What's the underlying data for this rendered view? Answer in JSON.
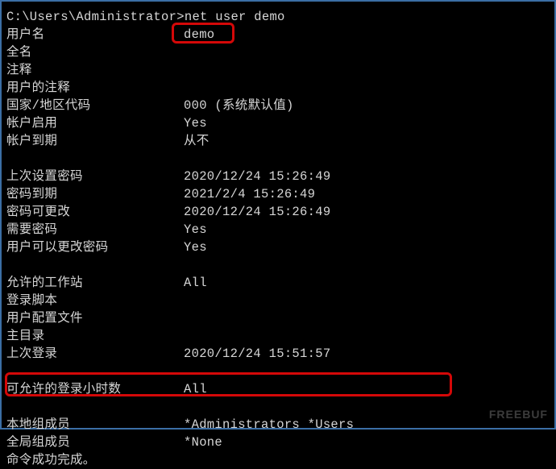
{
  "prompt": {
    "path": "C:\\Users\\Administrator>",
    "command": "net user demo"
  },
  "rows": [
    {
      "label": "用户名",
      "value": "demo"
    },
    {
      "label": "全名",
      "value": ""
    },
    {
      "label": "注释",
      "value": ""
    },
    {
      "label": "用户的注释",
      "value": ""
    },
    {
      "label": "国家/地区代码",
      "value": "000 (系统默认值)"
    },
    {
      "label": "帐户启用",
      "value": "Yes"
    },
    {
      "label": "帐户到期",
      "value": "从不"
    },
    {
      "blank": true
    },
    {
      "label": "上次设置密码",
      "value": "2020/12/24 15:26:49"
    },
    {
      "label": "密码到期",
      "value": "2021/2/4 15:26:49"
    },
    {
      "label": "密码可更改",
      "value": "2020/12/24 15:26:49"
    },
    {
      "label": "需要密码",
      "value": "Yes"
    },
    {
      "label": "用户可以更改密码",
      "value": "Yes"
    },
    {
      "blank": true
    },
    {
      "label": "允许的工作站",
      "value": "All"
    },
    {
      "label": "登录脚本",
      "value": ""
    },
    {
      "label": "用户配置文件",
      "value": ""
    },
    {
      "label": "主目录",
      "value": ""
    },
    {
      "label": "上次登录",
      "value": "2020/12/24 15:51:57"
    },
    {
      "blank": true
    },
    {
      "label": "可允许的登录小时数",
      "value": "All"
    },
    {
      "blank": true
    },
    {
      "label": "本地组成员",
      "value": "*Administrators       *Users"
    },
    {
      "label": "全局组成员",
      "value": "*None"
    }
  ],
  "completion": "命令成功完成。",
  "watermark": "FREEBUF"
}
